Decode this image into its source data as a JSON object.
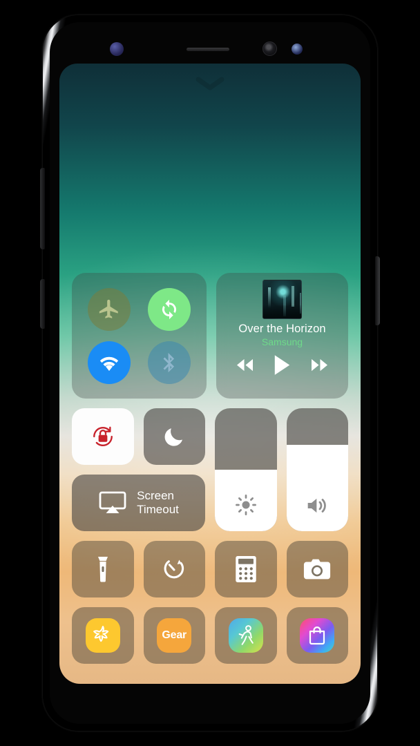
{
  "device": {
    "name": "samsung-galaxy-s8",
    "hardware": {
      "iris_scanner": "iris-sensor",
      "earpiece": "earpiece-speaker",
      "front_camera": "front-camera",
      "light_sensor": "light-sensor",
      "volume_key": "volume-rocker",
      "bixby_key": "bixby-button",
      "power_key": "power-button"
    }
  },
  "wallpaper": {
    "top_color": "#0f2f38",
    "mid_color": "#e3e1da",
    "bottom_color": "#e6b885"
  },
  "pull_handle": {
    "icon": "chevron-down-icon"
  },
  "control_center": {
    "connectivity": {
      "toggles": [
        {
          "id": "airplane-mode",
          "icon": "airplane-icon",
          "state": "off",
          "color": "#6f7a36"
        },
        {
          "id": "mobile-data",
          "icon": "sync-icon",
          "state": "on",
          "color": "#7ee887"
        },
        {
          "id": "wifi",
          "icon": "wifi-icon",
          "state": "on",
          "color": "#1a8cf5"
        },
        {
          "id": "bluetooth",
          "icon": "bluetooth-icon",
          "state": "off",
          "color": "#2f7fa8"
        }
      ]
    },
    "media": {
      "album_art": "album-artwork",
      "title": "Over the Horizon",
      "artist": "Samsung",
      "artist_color": "#6fd98a",
      "controls": [
        {
          "id": "previous",
          "icon": "rewind-icon"
        },
        {
          "id": "play",
          "icon": "play-icon"
        },
        {
          "id": "next",
          "icon": "fast-forward-icon"
        }
      ]
    },
    "toggles": {
      "rotation_lock": {
        "icon": "rotation-lock-icon",
        "state": "on",
        "accent": "#c8232c"
      },
      "night_mode": {
        "icon": "moon-icon",
        "state": "off"
      },
      "screen_timeout": {
        "icon": "screen-mirror-icon",
        "label_line1": "Screen",
        "label_line2": "Timeout"
      }
    },
    "sliders": [
      {
        "id": "brightness",
        "icon": "brightness-icon",
        "value": 50
      },
      {
        "id": "volume",
        "icon": "volume-icon",
        "value": 70
      }
    ],
    "shortcuts": [
      {
        "id": "flashlight",
        "icon": "flashlight-icon"
      },
      {
        "id": "timer",
        "icon": "timer-icon"
      },
      {
        "id": "calculator",
        "icon": "calculator-icon"
      },
      {
        "id": "camera",
        "icon": "camera-icon"
      }
    ],
    "apps": [
      {
        "id": "samsung-members",
        "icon": "flower-icon",
        "label": ""
      },
      {
        "id": "samsung-gear",
        "icon": "gear-app-icon",
        "label": "Gear"
      },
      {
        "id": "samsung-health",
        "icon": "runner-icon",
        "label": ""
      },
      {
        "id": "galaxy-store",
        "icon": "shopping-bag-icon",
        "label": ""
      }
    ]
  }
}
